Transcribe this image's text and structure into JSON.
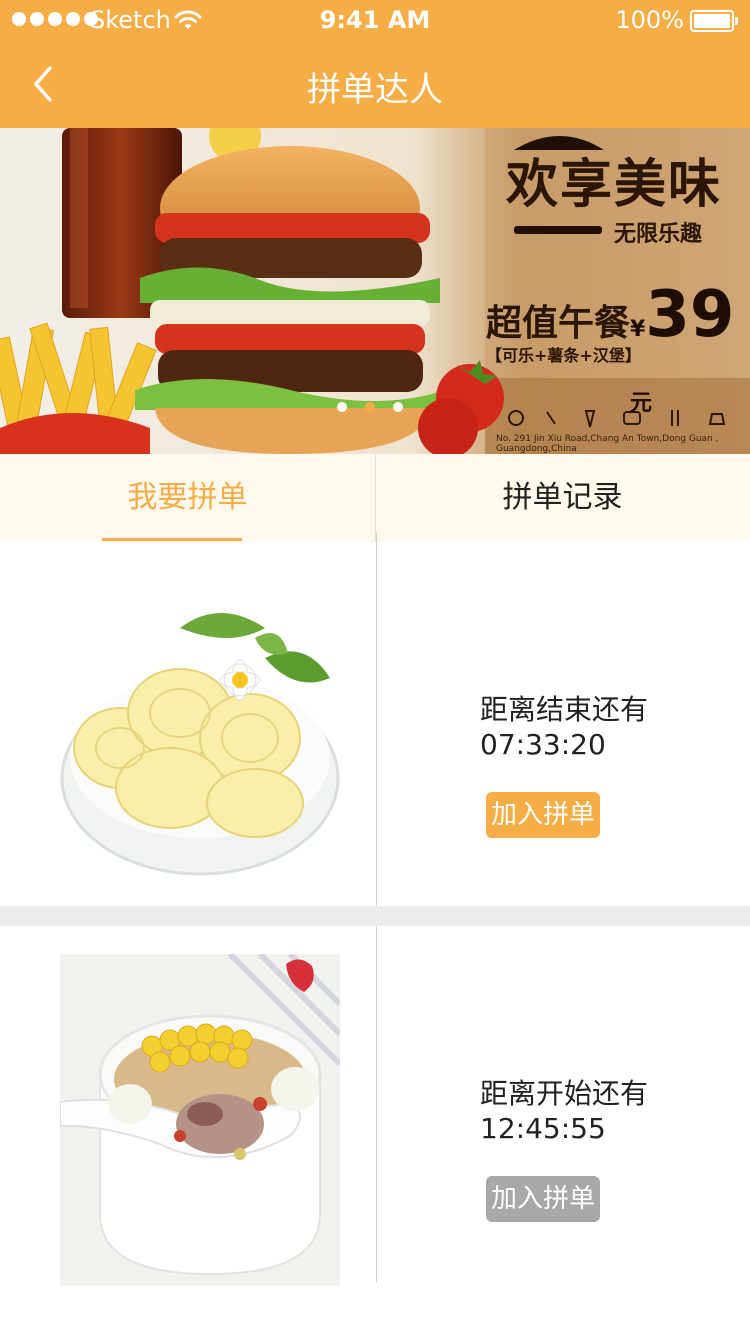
{
  "status_bar": {
    "carrier": "Sketch",
    "time": "9:41 AM",
    "battery": "100%",
    "signal_icon": "signal-dots-icon",
    "wifi_icon": "wifi-icon",
    "battery_icon": "battery-icon"
  },
  "nav": {
    "title": "拼单达人",
    "back_icon": "chevron-left-icon"
  },
  "banner": {
    "slogan": "欢享美味",
    "sub_slogan": "无限乐趣",
    "promo_title": "超值午餐",
    "promo_items": "【可乐+薯条+汉堡】",
    "price_symbol": "¥",
    "price": "39",
    "price_unit": "元",
    "address": "No. 291 Jin Xiu Road,Chang An Town,Dong Guan , Guangdong,China",
    "dots": 3,
    "active_dot": 2
  },
  "tabs": [
    {
      "label": "我要拼单",
      "active": true
    },
    {
      "label": "拼单记录",
      "active": false
    }
  ],
  "groups": [
    {
      "image": "butter-curls-image",
      "countdown_label": "距离结束还有",
      "countdown": "07:33:20",
      "button_label": "加入拼单",
      "button_state": "active"
    },
    {
      "image": "corn-soup-image",
      "countdown_label": "距离开始还有",
      "countdown": "12:45:55",
      "button_label": "加入拼单",
      "button_state": "disabled"
    }
  ],
  "colors": {
    "accent": "#f7ad45",
    "tab_background": "#fff8ed",
    "disabled_button": "#a8a8a8",
    "separator": "#ececec"
  }
}
